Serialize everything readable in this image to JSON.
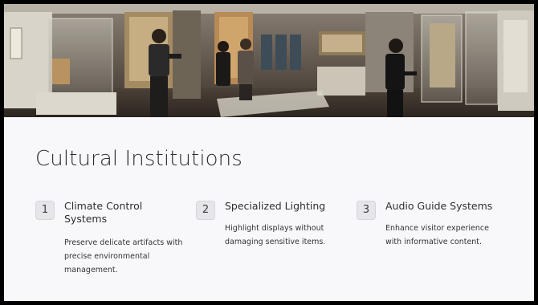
{
  "title": "Cultural Institutions",
  "items": [
    {
      "number": "1",
      "title_line1": "Climate Control",
      "title_line2": "Systems",
      "desc_line1": "Preserve delicate artifacts with",
      "desc_line2": "precise environmental",
      "desc_line3": "management."
    },
    {
      "number": "2",
      "title_line1": "Specialized Lighting",
      "desc_line1": "Highlight displays without",
      "desc_line2": "damaging sensitive items."
    },
    {
      "number": "3",
      "title_line1": "Audio Guide Systems",
      "desc_line1": "Enhance visitor experience",
      "desc_line2": "with informative content."
    }
  ],
  "colors": {
    "background": "#f8f8fa",
    "text": "#2f2d33",
    "badge": "#e6e6ea"
  }
}
